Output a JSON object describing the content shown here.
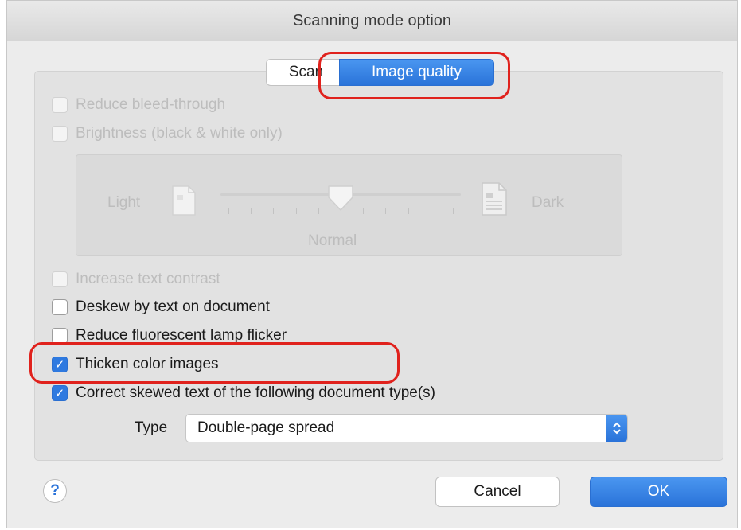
{
  "window": {
    "title": "Scanning mode option"
  },
  "tabs": [
    {
      "label": "Scan",
      "selected": false
    },
    {
      "label": "Image quality",
      "selected": true
    }
  ],
  "options": {
    "reduce_bleed": {
      "label": "Reduce bleed-through",
      "checked": false,
      "enabled": false
    },
    "brightness": {
      "label": "Brightness (black & white only)",
      "checked": false,
      "enabled": false
    },
    "increase_contrast": {
      "label": "Increase text contrast",
      "checked": false,
      "enabled": false
    },
    "deskew": {
      "label": "Deskew by text on document",
      "checked": false,
      "enabled": true
    },
    "reduce_flicker": {
      "label": "Reduce fluorescent lamp flicker",
      "checked": false,
      "enabled": true
    },
    "thicken": {
      "label": "Thicken color images",
      "checked": true,
      "enabled": true
    },
    "correct_skew": {
      "label": "Correct skewed text of the following document type(s)",
      "checked": true,
      "enabled": true
    }
  },
  "brightness_slider": {
    "light_label": "Light",
    "dark_label": "Dark",
    "normal_label": "Normal",
    "tick_count": 11,
    "value_fraction": 0.5
  },
  "type_select": {
    "label": "Type",
    "value": "Double-page spread"
  },
  "buttons": {
    "help": "?",
    "cancel": "Cancel",
    "ok": "OK"
  },
  "colors": {
    "accent": "#2a73d9",
    "highlight_outline": "#e0221d",
    "disabled_text": "#bdbdbd"
  },
  "icons": {
    "light_doc": "document-light-icon",
    "dark_doc": "document-dark-icon",
    "checkmark": "checkmark-icon",
    "select_arrows": "chevron-updown-icon",
    "help": "help-icon"
  }
}
